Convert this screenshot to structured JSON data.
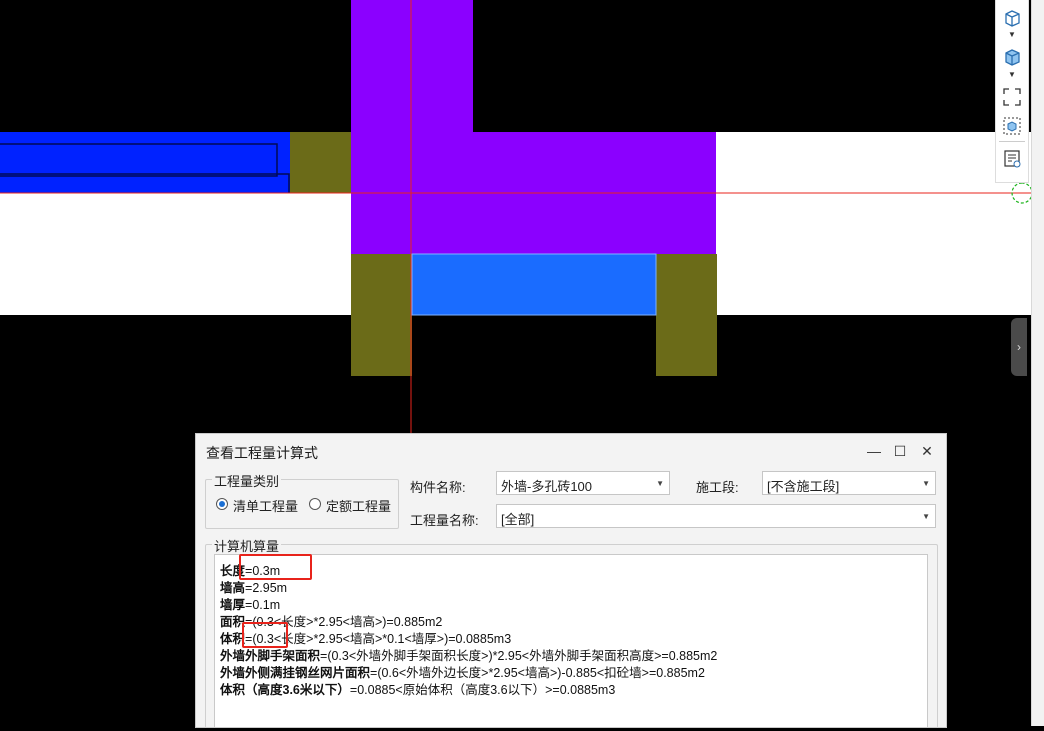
{
  "canvas": {
    "colors": {
      "background": "#000000",
      "white_band": "#ffffff",
      "purple_wall": "#8b00ff",
      "olive_column": "#6b6b18",
      "blue_wall": "#1a6cff",
      "left_blue_wall": "#0022ff",
      "crosshair": "#e8231b"
    }
  },
  "toolbar": {
    "icons": [
      "cube-icon",
      "dropdown-arrow-icon",
      "cube-filled-icon",
      "dropdown-arrow-icon",
      "fit-view-icon",
      "select-3d-icon",
      "list-view-icon"
    ]
  },
  "dialog": {
    "title": "查看工程量计算式",
    "minimize": "—",
    "maximize": "☐",
    "close": "✕",
    "qty_type": {
      "legend": "工程量类别",
      "options": [
        "清单工程量",
        "定额工程量"
      ],
      "selected": "清单工程量"
    },
    "component_name": {
      "label": "构件名称:",
      "value": "外墙-多孔砖100"
    },
    "construction_stage": {
      "label": "施工段:",
      "value": "[不含施工段]"
    },
    "qty_name": {
      "label": "工程量名称:",
      "value": "[全部]"
    },
    "calc": {
      "legend": "计算机算量",
      "lines": [
        {
          "name": "长度",
          "expr": "=0.3m"
        },
        {
          "name": "墙高",
          "expr": "=2.95m"
        },
        {
          "name": "墙厚",
          "expr": "=0.1m"
        },
        {
          "name": "面积",
          "expr": "=(0.3<长度>*2.95<墙高>)=0.885m2"
        },
        {
          "name": "体积",
          "expr": "=(0.3<长度>*2.95<墙高>*0.1<墙厚>)=0.0885m3"
        },
        {
          "name": "外墙外脚手架面积",
          "expr": "=(0.3<外墙外脚手架面积长度>)*2.95<外墙外脚手架面积高度>=0.885m2"
        },
        {
          "name": "外墙外侧满挂钢丝网片面积",
          "expr": "=(0.6<外墙外边长度>*2.95<墙高>)-0.885<扣砼墙>=0.885m2"
        },
        {
          "name": "体积（高度3.6米以下）",
          "expr": "=0.0885<原始体积（高度3.6以下）>=0.0885m3"
        }
      ]
    }
  }
}
